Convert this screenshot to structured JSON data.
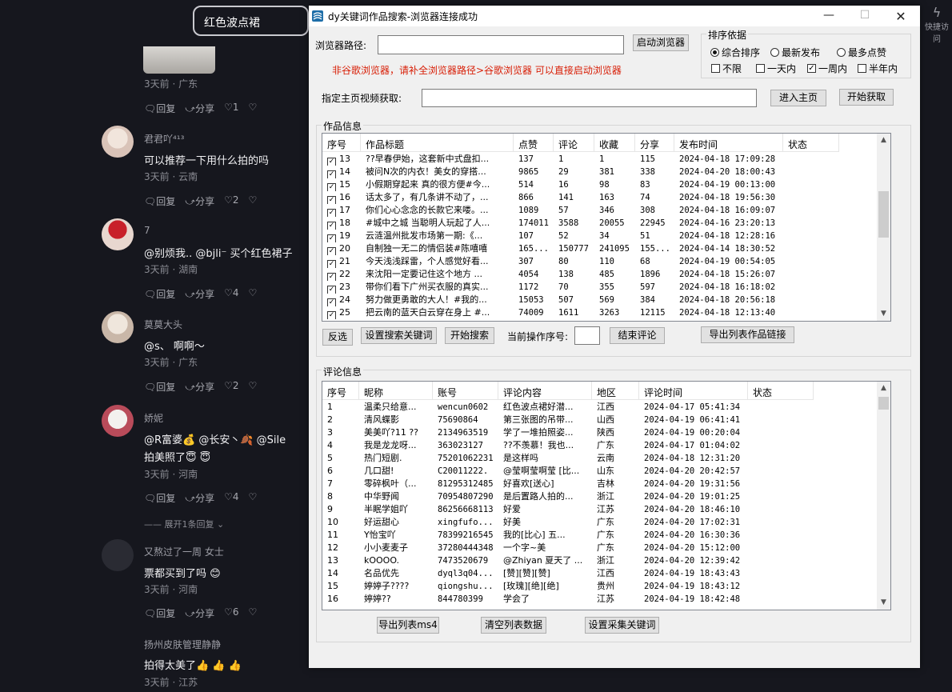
{
  "background": {
    "search_query": "红色波点裙",
    "quick_access_label": "快捷访问",
    "first_post": {
      "meta": "3天前 · 广东",
      "reply": "回复",
      "share": "分享",
      "likes": "1"
    },
    "comments": [
      {
        "name": "君君吖⁴¹³",
        "text": "可以推荐一下用什么拍的吗",
        "meta": "3天前 · 云南",
        "reply": "回复",
        "share": "分享",
        "likes": "2"
      },
      {
        "name": "7",
        "text": "@别烦我.. @bjli⁻ 买个红色裙子",
        "meta": "3天前 · 湖南",
        "reply": "回复",
        "share": "分享",
        "likes": "4"
      },
      {
        "name": "莫莫大头",
        "text": "@s、 啊啊～",
        "meta": "3天前 · 广东",
        "reply": "回复",
        "share": "分享",
        "likes": "2"
      },
      {
        "name": "娇妮",
        "text": "@R富婆💰 @长安丶🍂 @Sile",
        "text2": "拍美照了😇 😇",
        "meta": "3天前 · 河南",
        "reply": "回复",
        "share": "分享",
        "likes": "4"
      },
      {
        "name": "又熬过了一周 女士",
        "text": "票都买到了吗 😊",
        "meta": "3天前 · 河南",
        "reply": "回复",
        "share": "分享",
        "likes": "6"
      },
      {
        "name": "扬州皮肤管理静静",
        "text": "拍得太美了👍 👍 👍",
        "meta": "3天前 · 江苏"
      }
    ],
    "expand_replies": "展开1条回复"
  },
  "window": {
    "title": "dy关键词作品搜索-浏览器连接成功",
    "browser_path_label": "浏览器路径:",
    "browser_path_value": "",
    "launch_browser": "启动浏览器",
    "warning": "非谷歌浏览器，请补全浏览器路径>谷歌浏览器 可以直接启动浏览器",
    "sort_group": "排序依据",
    "sort_options": [
      "综合排序",
      "最新发布",
      "最多点赞"
    ],
    "time_options": [
      "不限",
      "一天内",
      "一周内",
      "半年内"
    ],
    "homepage_label": "指定主页视频获取:",
    "enter_home": "进入主页",
    "start_fetch": "开始获取",
    "works_group": "作品信息",
    "works_columns": [
      "序号",
      "作品标题",
      "点赞",
      "评论",
      "收藏",
      "分享",
      "发布时间",
      "状态"
    ],
    "works_rows": [
      [
        "13",
        "??早春伊始，这套新中式盘扣...",
        "137",
        "1",
        "1",
        "115",
        "2024-04-18 17:09:28",
        ""
      ],
      [
        "14",
        "被问N次的内衣！美女的穿搭...",
        "9865",
        "29",
        "381",
        "338",
        "2024-04-20 18:00:43",
        ""
      ],
      [
        "15",
        "小假期穿起来 真的很方便#今...",
        "514",
        "16",
        "98",
        "83",
        "2024-04-19 00:13:00",
        ""
      ],
      [
        "16",
        "话太多了，有几条讲不动了，...",
        "866",
        "141",
        "163",
        "74",
        "2024-04-18 19:56:30",
        ""
      ],
      [
        "17",
        "你们心心念念的长款它来喽。...",
        "1089",
        "57",
        "346",
        "308",
        "2024-04-18 16:09:07",
        ""
      ],
      [
        "18",
        "#城中之城 当聪明人玩起了人...",
        "174011",
        "3588",
        "20055",
        "22945",
        "2024-04-16 23:20:13",
        ""
      ],
      [
        "19",
        "云涟温州批发市场第一期:《...",
        "107",
        "52",
        "34",
        "51",
        "2024-04-18 12:28:16",
        ""
      ],
      [
        "20",
        "自制独一无二的情侣装#陈嘻嘻",
        "165...",
        "150777",
        "241095",
        "155...",
        "2024-04-14 18:30:52",
        ""
      ],
      [
        "21",
        "今天浅浅踩雷，个人感觉好看...",
        "307",
        "80",
        "110",
        "68",
        "2024-04-19 00:54:05",
        ""
      ],
      [
        "22",
        "来沈阳一定要记住这个地方 ...",
        "4054",
        "138",
        "485",
        "1896",
        "2024-04-18 15:26:07",
        ""
      ],
      [
        "23",
        "带你们看下广州买衣服的真实...",
        "1172",
        "70",
        "355",
        "597",
        "2024-04-18 16:18:02",
        ""
      ],
      [
        "24",
        "努力做更勇敢的大人！#我的...",
        "15053",
        "507",
        "569",
        "384",
        "2024-04-18 20:56:18",
        ""
      ],
      [
        "25",
        "把云南的蓝天白云穿在身上 #...",
        "74009",
        "1611",
        "3263",
        "12115",
        "2024-04-18 12:13:40",
        ""
      ]
    ],
    "invert": "反选",
    "set_keywords": "设置搜索关键词",
    "start_search": "开始搜索",
    "current_index_label": "当前操作序号:",
    "current_index_value": "",
    "end_comment": "结束评论",
    "export_links": "导出列表作品链接",
    "comments_group": "评论信息",
    "comment_columns": [
      "序号",
      "昵称",
      "账号",
      "评论内容",
      "地区",
      "评论时间",
      "状态"
    ],
    "comment_rows": [
      [
        "1",
        "温柔只给意...",
        "wencun0602",
        "红色波点裙好潜...",
        "江西",
        "2024-04-17 05:41:34",
        ""
      ],
      [
        "2",
        "清风蝶影",
        "75690864",
        "第三张图的吊带...",
        "山西",
        "2024-04-19 06:41:41",
        ""
      ],
      [
        "3",
        "美美吖?11 ??",
        "2134963519",
        "学了一堆拍照姿...",
        "陕西",
        "2024-04-19 00:20:04",
        ""
      ],
      [
        "4",
        "我是龙龙呀...",
        "363023127",
        "??不羡慕！我也...",
        "广东",
        "2024-04-17 01:04:02",
        ""
      ],
      [
        "5",
        "热门短剧.",
        "75201062231",
        "是这样吗",
        "云南",
        "2024-04-18 12:31:20",
        ""
      ],
      [
        "6",
        "几口甜!",
        "C20011222.",
        "@莹啊莹啊莹 [比...",
        "山东",
        "2024-04-20 20:42:57",
        ""
      ],
      [
        "7",
        "零碎枫叶（...",
        "81295312485",
        "好喜欢[送心]",
        "吉林",
        "2024-04-20 19:31:56",
        ""
      ],
      [
        "8",
        "中华野闻",
        "70954807290",
        "是后置路人拍的...",
        "浙江",
        "2024-04-20 19:01:25",
        ""
      ],
      [
        "9",
        "半眠学姐吖",
        "86256668113",
        "好爱",
        "江苏",
        "2024-04-20 18:46:10",
        ""
      ],
      [
        "10",
        "好运甜心",
        "xingfufo...",
        "好美",
        "广东",
        "2024-04-20 17:02:31",
        ""
      ],
      [
        "11",
        "Y怡宝吖",
        "78399216545",
        "我的[比心] 五...",
        "广东",
        "2024-04-20 16:30:36",
        ""
      ],
      [
        "12",
        "小小麦麦子",
        "37280444348",
        "一个字~美",
        "广东",
        "2024-04-20 15:12:00",
        ""
      ],
      [
        "13",
        "kOOOO.",
        "7473520679",
        "@Zhiyan 夏天了 ...",
        "浙江",
        "2024-04-20 12:39:42",
        ""
      ],
      [
        "14",
        "名品优先",
        "dyql3q04...",
        "[赞][赞][赞]",
        "江西",
        "2024-04-19 18:43:43",
        ""
      ],
      [
        "15",
        "婷婷子????",
        "qiongshu...",
        "[玫瑰][绝][绝]",
        "贵州",
        "2024-04-19 18:43:12",
        ""
      ],
      [
        "16",
        "婷婷??",
        "844780399",
        "学会了",
        "江苏",
        "2024-04-19 18:42:48",
        ""
      ]
    ],
    "export_ms4": "导出列表ms4",
    "clear_list": "清空列表数据",
    "set_collect_keywords": "设置采集关键词"
  }
}
